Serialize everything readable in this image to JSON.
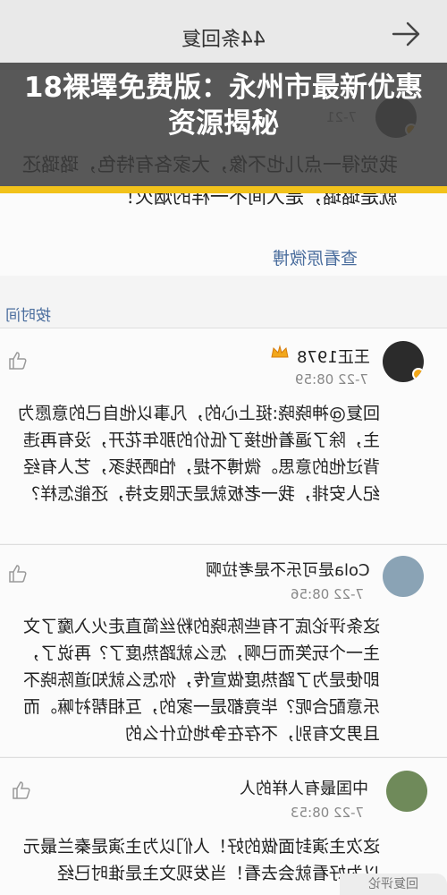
{
  "header": {
    "reply_count_label": "44条回复"
  },
  "banner": {
    "title": "18裸墿免费版：永州市最新优惠资源揭秘"
  },
  "post": {
    "timestamp": "7-21",
    "text": "我觉得一点儿也不像，大家各有特色，璐璐还就是璐璐，是人间不一样的烟火！",
    "view_original_label": "查看原微博"
  },
  "sort": {
    "label": "按时间"
  },
  "comments": [
    {
      "username": "王正1978",
      "timestamp": "7-22 08:59",
      "text": "回复@神晓晓:挺上心的，凡事以他自己的意愿为主，除了逼着他接了低价的那年花开，没有再违背过他的意思。微博不提，怕晒残豕，艺人有经纪人安排，我一老板就是无限支持，还能怎样？"
    },
    {
      "username": "Cola是可乐不是考拉啊",
      "timestamp": "7-22 08:56",
      "text": "这条评论底下有些陈晓的粉丝简直走火入魔了文主一个玩笑而已啊，怎么就踏热度了？再说了，即使是为了踏热度做宣传，你怎么就知道陈晓不乐意配合呢？毕竟都是一家的，互相帮衬嘛。而且男文有别，不存在争地位什么的"
    },
    {
      "username": "中国最有人样的人",
      "timestamp": "7-22 08:53",
      "text": "这次主演封面做的好！人们以为主演是秦兰最元以为好看就会去看！当发现文主是谁时已经"
    }
  ],
  "reply_box": {
    "placeholder": "回复评论"
  },
  "colors": {
    "banner_bg": "#3c3c3c",
    "banner_accent": "#f2c21a",
    "link": "#4b6e9e"
  }
}
